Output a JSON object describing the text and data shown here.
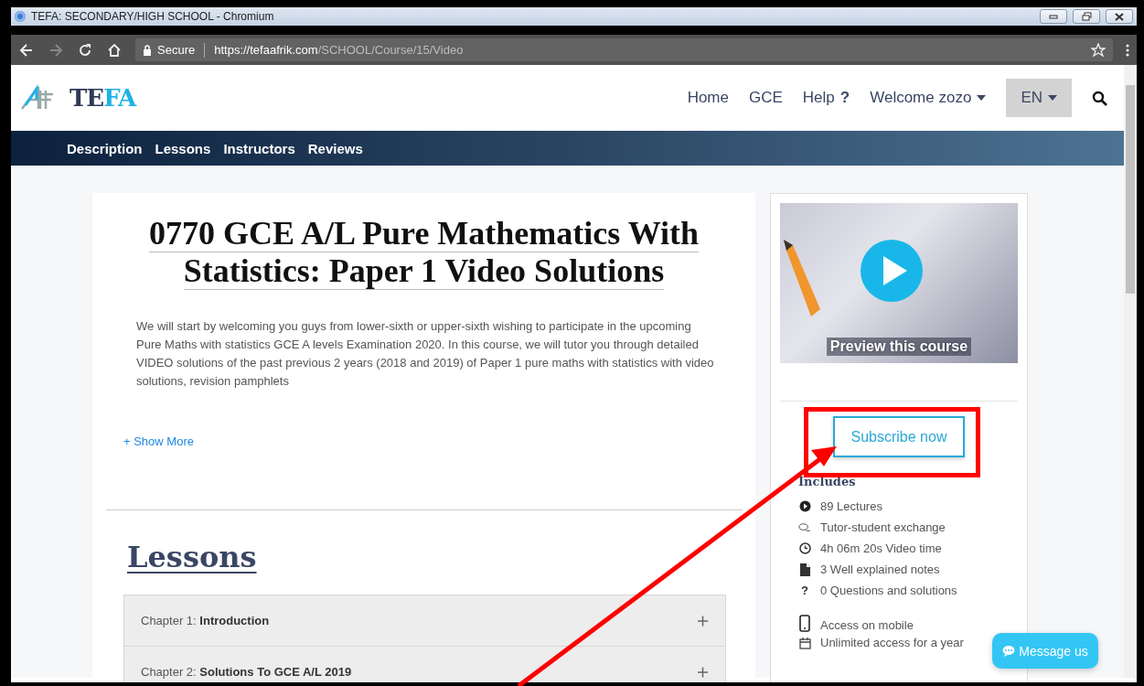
{
  "window": {
    "title": "TEFA: SECONDARY/HIGH SCHOOL - Chromium"
  },
  "address_bar": {
    "security": "Secure",
    "url_host": "https://tefaafrik.com",
    "url_path": "/SCHOOL/Course/15/Video"
  },
  "logo": {
    "parts": [
      {
        "text": "TE",
        "color": "#2f3a56"
      },
      {
        "text": "FA",
        "color": "#1fb1e6"
      }
    ]
  },
  "nav": [
    {
      "label": "Home",
      "dropdown": false
    },
    {
      "label": "GCE",
      "dropdown": false
    },
    {
      "label": "Help",
      "suffix": "?",
      "dropdown": false
    },
    {
      "label": "Welcome zozo",
      "dropdown": true
    }
  ],
  "language": {
    "label": "EN",
    "dropdown": true
  },
  "tabs": [
    {
      "label": "Description"
    },
    {
      "label": "Lessons"
    },
    {
      "label": "Instructors"
    },
    {
      "label": "Reviews"
    }
  ],
  "course": {
    "title": "0770 GCE A/L Pure Mathematics With Statistics: Paper 1 Video Solutions",
    "description": "We will start by welcoming you guys from lower-sixth or upper-sixth wishing to participate in the upcoming Pure Maths with statistics GCE A levels Examination 2020. In this course, we will tutor you through detailed VIDEO solutions of the past previous 2 years (2018 and 2019) of Paper 1 pure maths with statistics with video solutions, revision pamphlets",
    "show_more": "+ Show More",
    "lessons_heading": "Lessons",
    "chapters": [
      {
        "text": "Chapter 1: **Introduction**",
        "expanded": false
      },
      {
        "text": "Chapter 2: **Solutions To GCE A/L 2019**",
        "expanded": false
      }
    ]
  },
  "sidebar": {
    "preview_label": "Preview this course",
    "subscribe": "Subscribe now",
    "includes_heading": "Includes",
    "includes": [
      {
        "kind": "play",
        "text": "89 Lectures"
      },
      {
        "kind": "chat",
        "text": "Tutor-student exchange"
      },
      {
        "kind": "clock",
        "text": "4h 06m 20s Video time"
      },
      {
        "kind": "file",
        "text": "3 Well explained notes"
      },
      {
        "kind": "question",
        "glyph": "?",
        "text": "0 Questions and solutions"
      },
      {
        "kind": "mobile",
        "text": "Access on mobile"
      },
      {
        "kind": "calendar",
        "text": "Unlimited access for a year"
      }
    ]
  },
  "message_button": "Message us"
}
